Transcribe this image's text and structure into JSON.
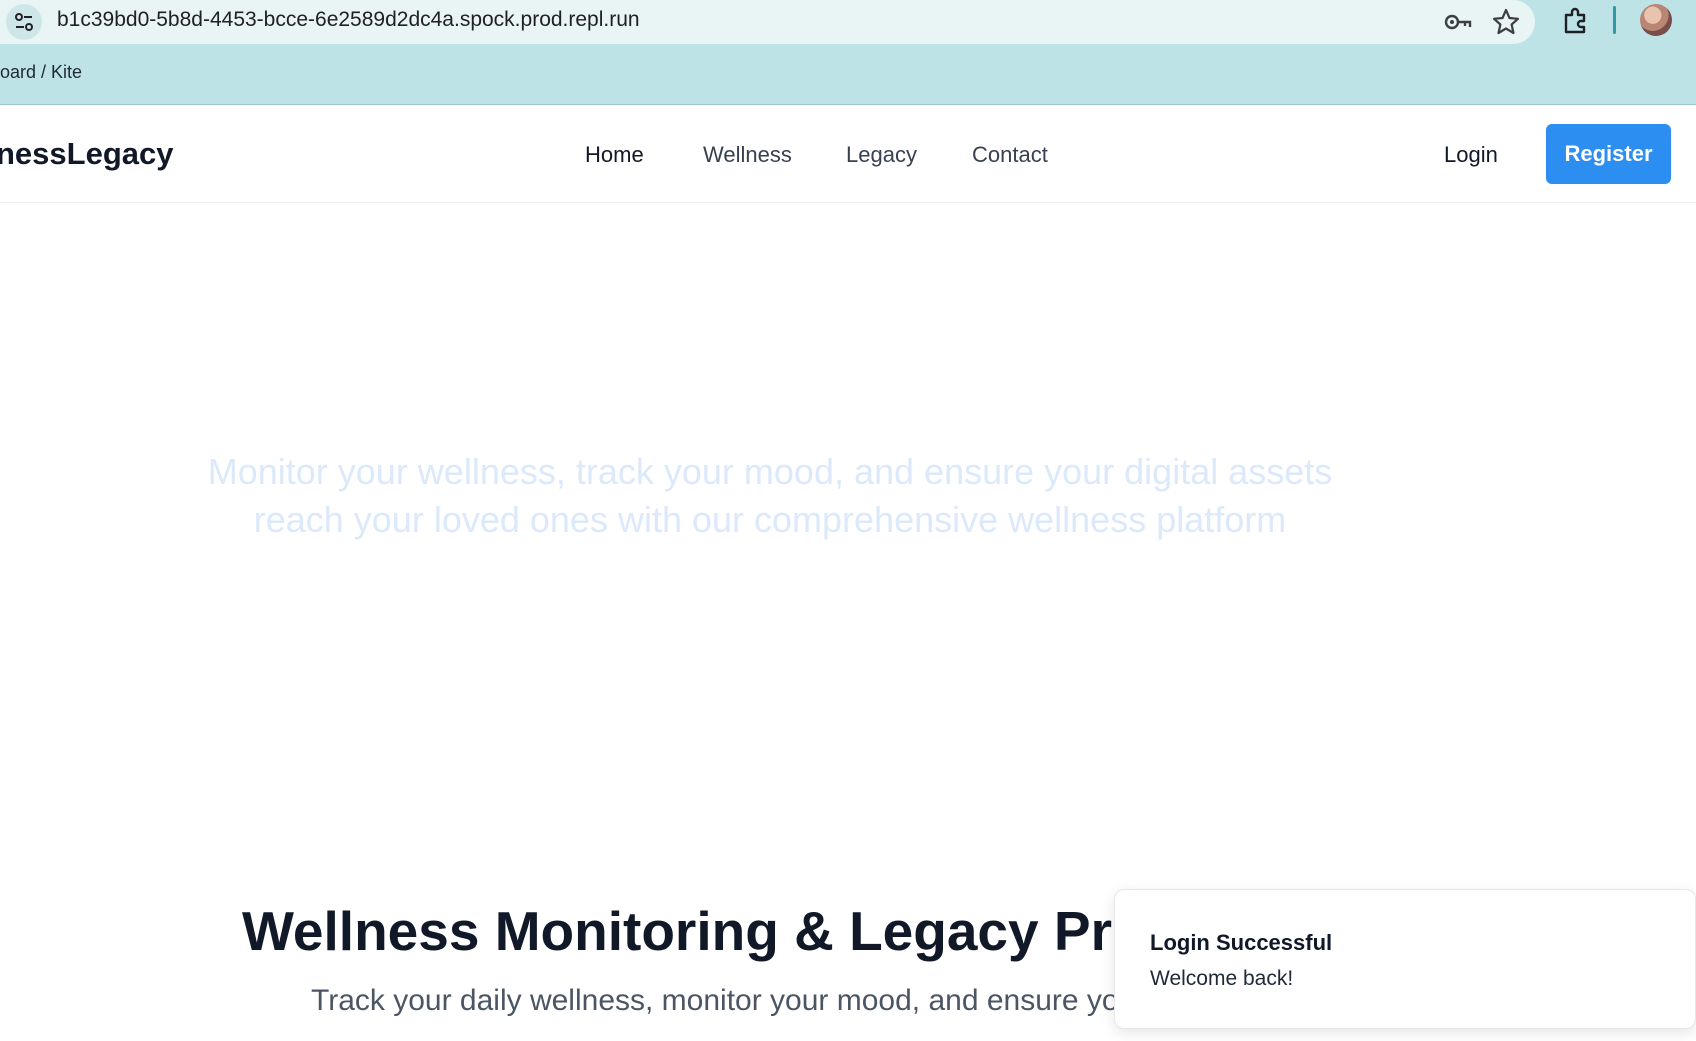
{
  "browser": {
    "url": "b1c39bd0-5b8d-4453-bcce-6e2589d2dc4a.spock.prod.repl.run",
    "bookmark_bar_text": "oard / Kite",
    "icons": {
      "site_info": "tune-icon",
      "password": "key-icon",
      "bookmark": "star-icon",
      "extensions": "puzzle-icon",
      "profile": "avatar"
    }
  },
  "header": {
    "brand": "nessLegacy",
    "nav": [
      "Home",
      "Wellness",
      "Legacy",
      "Contact"
    ],
    "login_label": "Login",
    "register_label": "Register"
  },
  "hero": {
    "text": "Monitor your wellness, track your mood, and ensure your digital assets reach your loved ones with our comprehensive wellness platform"
  },
  "section": {
    "title": "Wellness Monitoring & Legacy Pro",
    "subtitle": "Track your daily wellness, monitor your mood, and ensure yo"
  },
  "toast": {
    "title": "Login Successful",
    "message": "Welcome back!"
  },
  "colors": {
    "chrome_bg": "#bde3e6",
    "accent": "#2b8ef0",
    "hero_text": "#dce9fb"
  }
}
